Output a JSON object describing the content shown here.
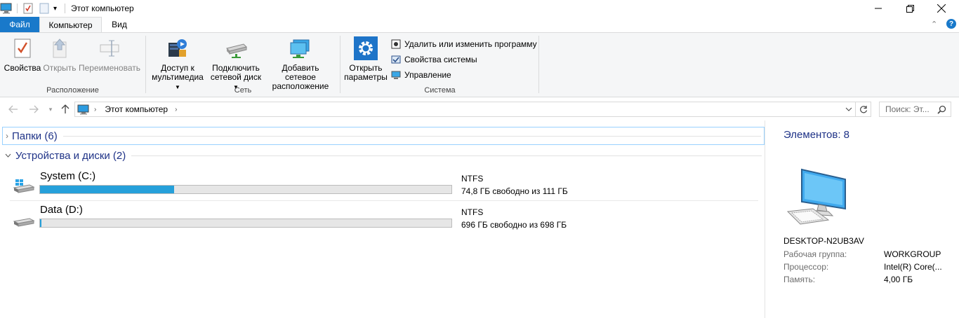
{
  "window": {
    "title": "Этот компьютер"
  },
  "ribbon_tabs": {
    "file": "Файл",
    "computer": "Компьютер",
    "view": "Вид"
  },
  "ribbon": {
    "location_group": {
      "label": "Расположение",
      "properties": "Свойства",
      "open": "Открыть",
      "rename": "Переименовать"
    },
    "network_group": {
      "label": "Сеть",
      "media_access_line1": "Доступ к",
      "media_access_line2": "мультимедиа",
      "map_drive_line1": "Подключить",
      "map_drive_line2": "сетевой диск",
      "add_location_line1": "Добавить сетевое",
      "add_location_line2": "расположение"
    },
    "system_group": {
      "label": "Система",
      "open_settings_line1": "Открыть",
      "open_settings_line2": "параметры",
      "uninstall": "Удалить или изменить программу",
      "system_properties": "Свойства системы",
      "manage": "Управление"
    }
  },
  "address_bar": {
    "path": "Этот компьютер",
    "search_placeholder": "Поиск: Эт..."
  },
  "sections": {
    "folders": "Папки (6)",
    "devices": "Устройства и диски (2)"
  },
  "drives": [
    {
      "name": "System (C:)",
      "fs": "NTFS",
      "free_text": "74,8 ГБ свободно из 111 ГБ",
      "used_fraction": 0.326
    },
    {
      "name": "Data (D:)",
      "fs": "NTFS",
      "free_text": "696 ГБ свободно из 698 ГБ",
      "used_fraction": 0.003
    }
  ],
  "details": {
    "count": "Элементов: 8",
    "computer_name": "DESKTOP-N2UB3AV",
    "workgroup_label": "Рабочая группа:",
    "workgroup_value": "WORKGROUP",
    "cpu_label": "Процессор:",
    "cpu_value": "Intel(R) Core(...",
    "memory_label": "Память:",
    "memory_value": "4,00 ГБ"
  },
  "colors": {
    "accent": "#1979ca",
    "drive_bar": "#26a0da",
    "section_text": "#1e3287"
  }
}
